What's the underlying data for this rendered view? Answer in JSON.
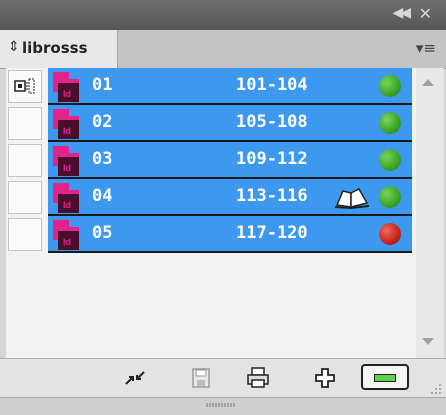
{
  "panel": {
    "tab_label": "librosss",
    "tab_arrows": "⇕"
  },
  "rows": [
    {
      "name": "01",
      "pages": "101-104",
      "status_color": "#3aa324"
    },
    {
      "name": "02",
      "pages": "105-108",
      "status_color": "#3aa324"
    },
    {
      "name": "03",
      "pages": "109-112",
      "status_color": "#3aa324"
    },
    {
      "name": "04",
      "pages": "113-116",
      "status_color": "#3aa324"
    },
    {
      "name": "05",
      "pages": "117-120",
      "status_color": "#c82318"
    }
  ],
  "colors": {
    "selection": "#3d99ef",
    "indesign_pink": "#e3238c",
    "indesign_dark": "#4a0d2b"
  }
}
